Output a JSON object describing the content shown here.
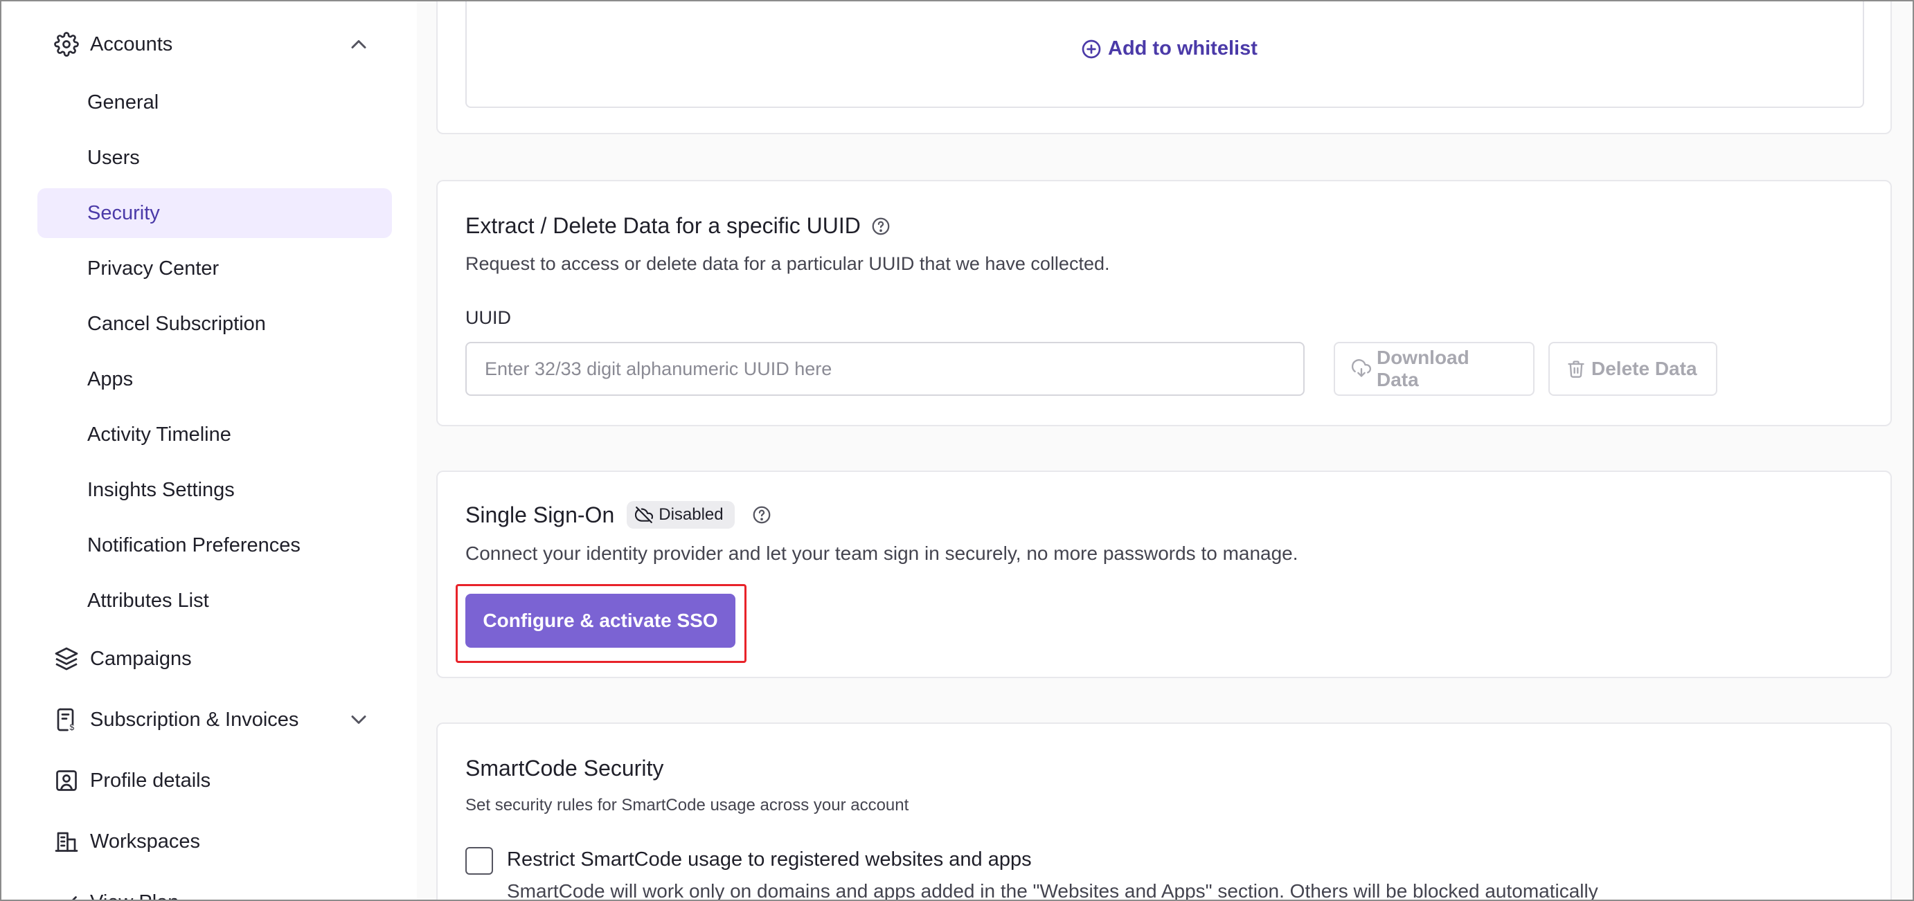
{
  "sidebar": {
    "accounts": {
      "label": "Accounts",
      "icon": "gear-icon",
      "expanded": true
    },
    "account_items": [
      {
        "label": "General"
      },
      {
        "label": "Users"
      },
      {
        "label": "Security",
        "active": true
      },
      {
        "label": "Privacy Center"
      },
      {
        "label": "Cancel Subscription"
      },
      {
        "label": "Apps"
      },
      {
        "label": "Activity Timeline"
      },
      {
        "label": "Insights Settings"
      },
      {
        "label": "Notification Preferences"
      },
      {
        "label": "Attributes List"
      }
    ],
    "campaigns": {
      "label": "Campaigns",
      "icon": "layers-icon"
    },
    "subscription": {
      "label": "Subscription & Invoices",
      "icon": "invoice-icon"
    },
    "profile": {
      "label": "Profile details",
      "icon": "user-card-icon"
    },
    "workspaces": {
      "label": "Workspaces",
      "icon": "building-icon"
    },
    "view_plan": {
      "label": "View Plan",
      "icon": "plan-icon"
    }
  },
  "whitelist": {
    "add_label": "Add to whitelist"
  },
  "extract": {
    "title": "Extract / Delete Data for a specific UUID",
    "description": "Request to access or delete data for a particular UUID that we have collected.",
    "uuid_label": "UUID",
    "uuid_placeholder": "Enter 32/33 digit alphanumeric UUID here",
    "download_label": "Download Data",
    "delete_label": "Delete Data"
  },
  "sso": {
    "title": "Single Sign-On",
    "status": "Disabled",
    "description": "Connect your identity provider and let your team sign in securely, no more passwords to manage.",
    "button_label": "Configure & activate SSO"
  },
  "smartcode": {
    "title": "SmartCode Security",
    "description": "Set security rules for SmartCode usage across your account",
    "option_label": "Restrict SmartCode usage to registered websites and apps",
    "option_desc": "SmartCode will work only on domains and apps added in the \"Websites and Apps\" section. Others will be blocked automatically",
    "option_checked": false
  },
  "colors": {
    "accent": "#7b63d3",
    "accent_text": "#4b3aa8",
    "highlight": "#e8232a",
    "active_bg": "#f1ecff"
  }
}
